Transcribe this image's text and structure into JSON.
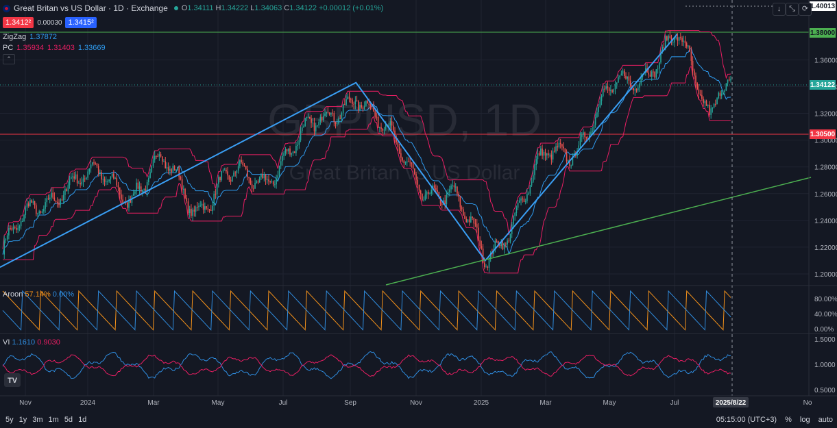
{
  "header": {
    "title": "Great Britan vs US Dollar · 1D · Exchange",
    "o_label": "O",
    "o": "1.34111",
    "h_label": "H",
    "h": "1.34222",
    "l_label": "L",
    "l": "1.34063",
    "c_label": "C",
    "c": "1.34122",
    "change": "+0.00012 (+0.01%)",
    "sell_price": "1.3412²",
    "spread": "0.00030",
    "buy_price": "1.3415²"
  },
  "indicators": {
    "zigzag": {
      "name": "ZigZag",
      "value": "1.37872"
    },
    "pc": {
      "name": "PC",
      "v1": "1.35934",
      "v2": "1.31403",
      "v3": "1.33669"
    },
    "aroon": {
      "name": "Aroon",
      "up": "57.14%",
      "down": "0.00%"
    },
    "vi": {
      "name": "VI",
      "plus": "1.1610",
      "minus": "0.9030"
    }
  },
  "watermark": {
    "symbol": "GBPUSD, 1D",
    "name": "Great Britan vs US Dollar"
  },
  "price_axis": {
    "ticks": [
      "1.36000",
      "1.34000",
      "1.32000",
      "1.30000",
      "1.28000",
      "1.26000",
      "1.24000",
      "1.22000",
      "1.20000"
    ],
    "top_label": "1.40013",
    "line_high": "1.38000",
    "current": "1.34122",
    "line_low": "1.30500"
  },
  "aroon_axis": [
    "80.00%",
    "40.00%",
    "0.00%"
  ],
  "vi_axis": [
    "1.5000",
    "1.0000",
    "0.5000"
  ],
  "time_axis": {
    "labels": [
      "Nov",
      "2024",
      "Mar",
      "May",
      "Jul",
      "Sep",
      "Nov",
      "2025",
      "Mar",
      "May",
      "Jul",
      "No"
    ],
    "cursor_date": "2025/8/22"
  },
  "bottom_bar": {
    "timeframes": [
      "5y",
      "1y",
      "3m",
      "1m",
      "5d",
      "1d"
    ],
    "clock": "05:15:00 (UTC+3)",
    "percent": "%",
    "log": "log",
    "auto": "auto"
  },
  "colors": {
    "up": "#26a69a",
    "down": "#ef5350",
    "zigzag": "#2f9cf0",
    "channel": "#e91e63",
    "mid": "#2f9cf0",
    "trend": "#4caf50",
    "aroon_up": "#f7931a",
    "aroon_down": "#2f8de0"
  },
  "chart_data": {
    "type": "candlestick",
    "symbol": "GBPUSD",
    "x_range": [
      "2023-10",
      "2025-08-22"
    ],
    "y_range": [
      1.19,
      1.4
    ],
    "zigzag_points": [
      {
        "date": "2023-10",
        "value": 1.205
      },
      {
        "date": "2024-09",
        "value": 1.343
      },
      {
        "date": "2025-01",
        "value": 1.21
      },
      {
        "date": "2025-07",
        "value": 1.379
      }
    ],
    "close_path": [
      {
        "date": "2023-10",
        "value": 1.215
      },
      {
        "date": "2023-11",
        "value": 1.245
      },
      {
        "date": "2023-12",
        "value": 1.27
      },
      {
        "date": "2024-01",
        "value": 1.27
      },
      {
        "date": "2024-02",
        "value": 1.263
      },
      {
        "date": "2024-03",
        "value": 1.282
      },
      {
        "date": "2024-04",
        "value": 1.25
      },
      {
        "date": "2024-05",
        "value": 1.273
      },
      {
        "date": "2024-06",
        "value": 1.265
      },
      {
        "date": "2024-07",
        "value": 1.298
      },
      {
        "date": "2024-08",
        "value": 1.31
      },
      {
        "date": "2024-09",
        "value": 1.34
      },
      {
        "date": "2024-10",
        "value": 1.3
      },
      {
        "date": "2024-11",
        "value": 1.27
      },
      {
        "date": "2024-12",
        "value": 1.255
      },
      {
        "date": "2025-01",
        "value": 1.215
      },
      {
        "date": "2025-02",
        "value": 1.245
      },
      {
        "date": "2025-03",
        "value": 1.29
      },
      {
        "date": "2025-04",
        "value": 1.3
      },
      {
        "date": "2025-05",
        "value": 1.335
      },
      {
        "date": "2025-06",
        "value": 1.355
      },
      {
        "date": "2025-07",
        "value": 1.375
      },
      {
        "date": "2025-07-20",
        "value": 1.34
      },
      {
        "date": "2025-08-01",
        "value": 1.32
      },
      {
        "date": "2025-08-10",
        "value": 1.35
      },
      {
        "date": "2025-08-22",
        "value": 1.341
      }
    ]
  }
}
